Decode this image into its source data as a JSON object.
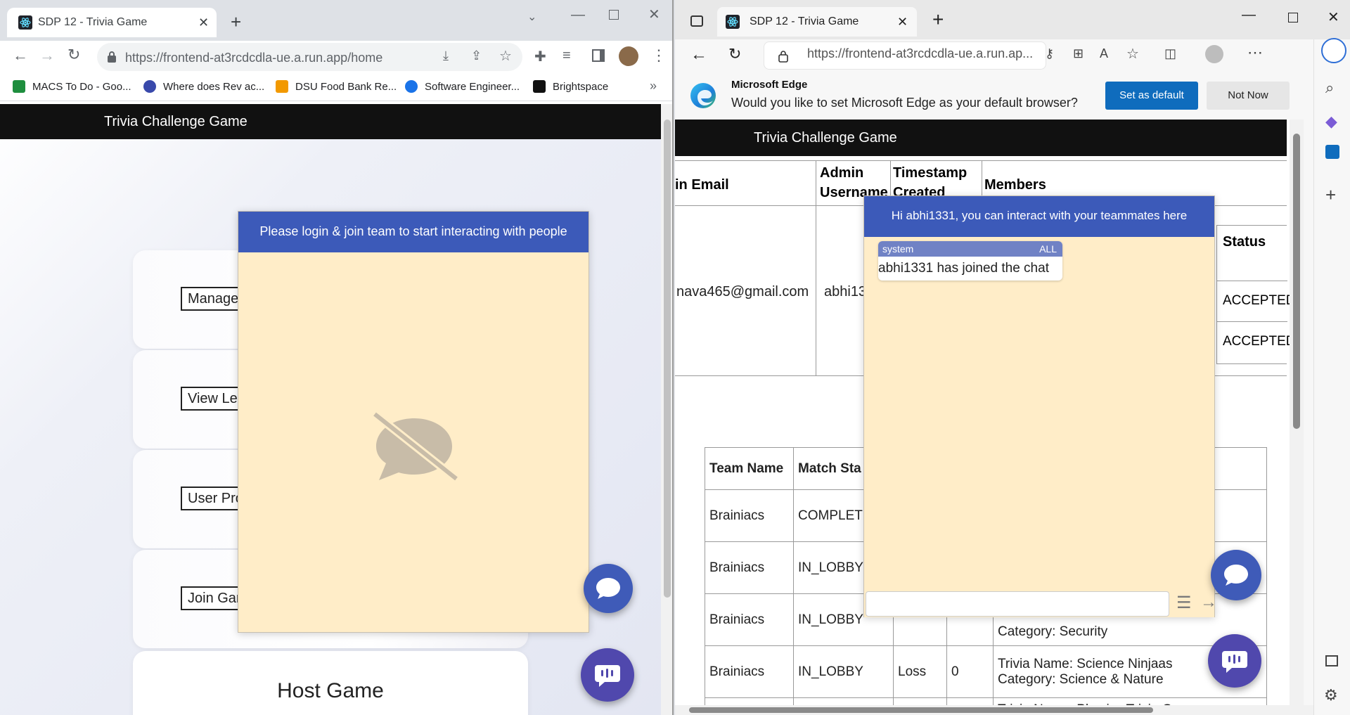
{
  "left_window": {
    "tab_title": "SDP 12 - Trivia Game",
    "url": "https://frontend-at3rcdcdla-ue.a.run.app/home",
    "bookmarks": [
      {
        "label": "MACS To Do - Goo...",
        "color": "#1e8e3e"
      },
      {
        "label": "Where does Rev ac...",
        "color": "#3949ab"
      },
      {
        "label": "DSU Food Bank Re...",
        "color": "#f29900"
      },
      {
        "label": "Software Engineer...",
        "color": "#1a73e8"
      },
      {
        "label": "Brightspace",
        "color": "#111111"
      }
    ],
    "bookmarks_overflow": "»",
    "navbar_title": "Trivia Challenge Game",
    "menu_buttons": [
      "Manage",
      "View Lea",
      "User Pro",
      "Join Gar"
    ],
    "host_game_label": "Host Game",
    "chat_header": "Please login & join team to start interacting with people",
    "chat_empty_icon": "chat-disabled-icon"
  },
  "right_window": {
    "tab_title": "SDP 12 - Trivia Game",
    "url": "https://frontend-at3rcdcdla-ue.a.run.ap...",
    "banner": {
      "title": "Microsoft Edge",
      "message": "Would you like to set Microsoft Edge as your default browser?",
      "primary": "Set as default",
      "secondary": "Not Now"
    },
    "navbar_title": "Trivia Challenge Game",
    "team_table": {
      "headers": [
        "in Email",
        "Admin Username",
        "Timestamp Created",
        "Members"
      ],
      "email": "nava465@gmail.com",
      "username": "abhi13",
      "status_header": "Status",
      "statuses": [
        "ACCEPTED",
        "ACCEPTED"
      ]
    },
    "games_table": {
      "headers": [
        "Team Name",
        "Match Sta"
      ],
      "rows": [
        {
          "team": "Brainiacs",
          "status": "COMPLETE",
          "result": "",
          "score": "",
          "info": ""
        },
        {
          "team": "Brainiacs",
          "status": "IN_LOBBY",
          "result": "",
          "score": "",
          "info": ""
        },
        {
          "team": "Brainiacs",
          "status": "IN_LOBBY",
          "result": "",
          "score": "",
          "info": "Category: Security"
        },
        {
          "team": "Brainiacs",
          "status": "IN_LOBBY",
          "result": "Loss",
          "score": "0",
          "info": "Trivia Name: Science Ninjaas",
          "info2": "Category: Science & Nature"
        },
        {
          "team": "",
          "status": "",
          "result": "",
          "score": "",
          "info": "Trivia Name: Physics Trivia Game"
        }
      ]
    },
    "chat": {
      "header": "Hi abhi1331, you can interact with your teammates here",
      "messages": [
        {
          "sender": "system",
          "audience": "ALL",
          "text": "abhi1331 has joined the chat"
        }
      ],
      "input_placeholder": ""
    }
  },
  "colors": {
    "chat_header": "#3c5ab9",
    "chat_body": "#ffedc8",
    "fab": "#3f5bb8",
    "edge_button": "#0f6cbd"
  }
}
